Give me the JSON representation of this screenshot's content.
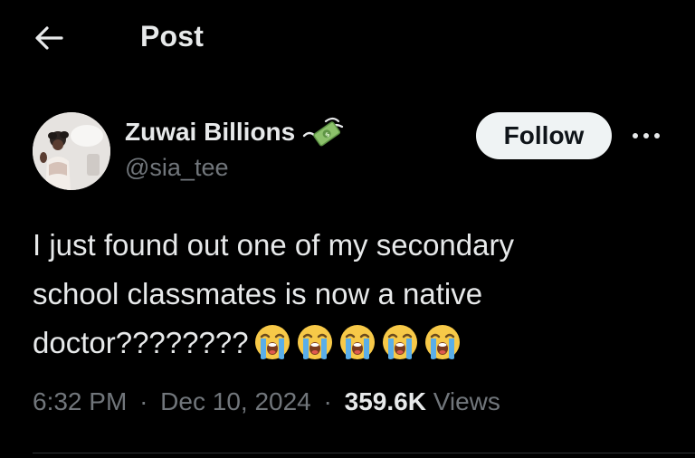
{
  "header": {
    "title": "Post",
    "back_icon": "arrow-left-icon"
  },
  "author": {
    "display_name": "Zuwai Billions",
    "badge_icon": "money-with-wings-emoji",
    "handle": "@sia_tee",
    "avatar_icon": "profile-avatar"
  },
  "actions": {
    "follow_label": "Follow",
    "more_icon": "more-horizontal-icon"
  },
  "post": {
    "lines": [
      "I just found out one of my secondary",
      "school classmates is now a native",
      "doctor????????"
    ],
    "trailing_emoji": "loudly-crying-face-emoji",
    "trailing_emoji_count": 5
  },
  "meta": {
    "time": "6:32 PM",
    "date": "Dec 10, 2024",
    "separator": "·",
    "views_count": "359.6K",
    "views_label": "Views"
  },
  "colors": {
    "background": "#000000",
    "primary_text": "#e7e9ea",
    "secondary_text": "#71767b",
    "follow_button_bg": "#eff3f4",
    "follow_button_text": "#0f1419",
    "divider": "#2f3336"
  }
}
